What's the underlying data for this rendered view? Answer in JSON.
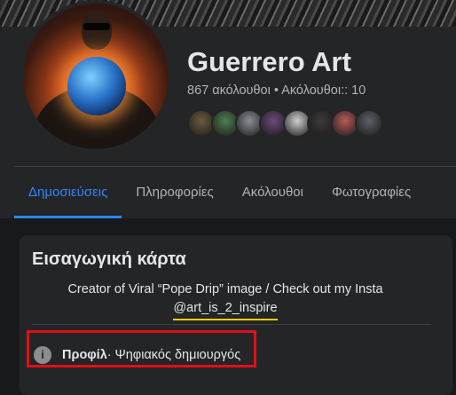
{
  "profile": {
    "name": "Guerrero Art",
    "stats": "867 ακόλουθοι • Ακόλουθοι:: 10",
    "friend_colors": [
      "#6b5b3e",
      "#4f7f52",
      "#8a8f96",
      "#6b4a7a",
      "#cfcfcf",
      "#3a3a3a",
      "#b85a5a",
      "#5c6066"
    ]
  },
  "tabs": [
    {
      "label": "Δημοσιεύσεις",
      "active": true
    },
    {
      "label": "Πληροφορίες",
      "active": false
    },
    {
      "label": "Ακόλουθοι",
      "active": false
    },
    {
      "label": "Φωτογραφίες",
      "active": false
    }
  ],
  "intro": {
    "title": "Εισαγωγική κάρτα",
    "bio_line1": "Creator of Viral “Pope Drip” image / Check out my Insta",
    "bio_handle": "@art_is_2_inspire",
    "info_icon": "info-icon",
    "info_bold": "Προφίλ",
    "info_rest": " · Ψηφιακός δημιουργός"
  },
  "colors": {
    "accent": "#2d88ff",
    "highlight_box": "#e0101a",
    "handle_underline": "#f2d100"
  }
}
